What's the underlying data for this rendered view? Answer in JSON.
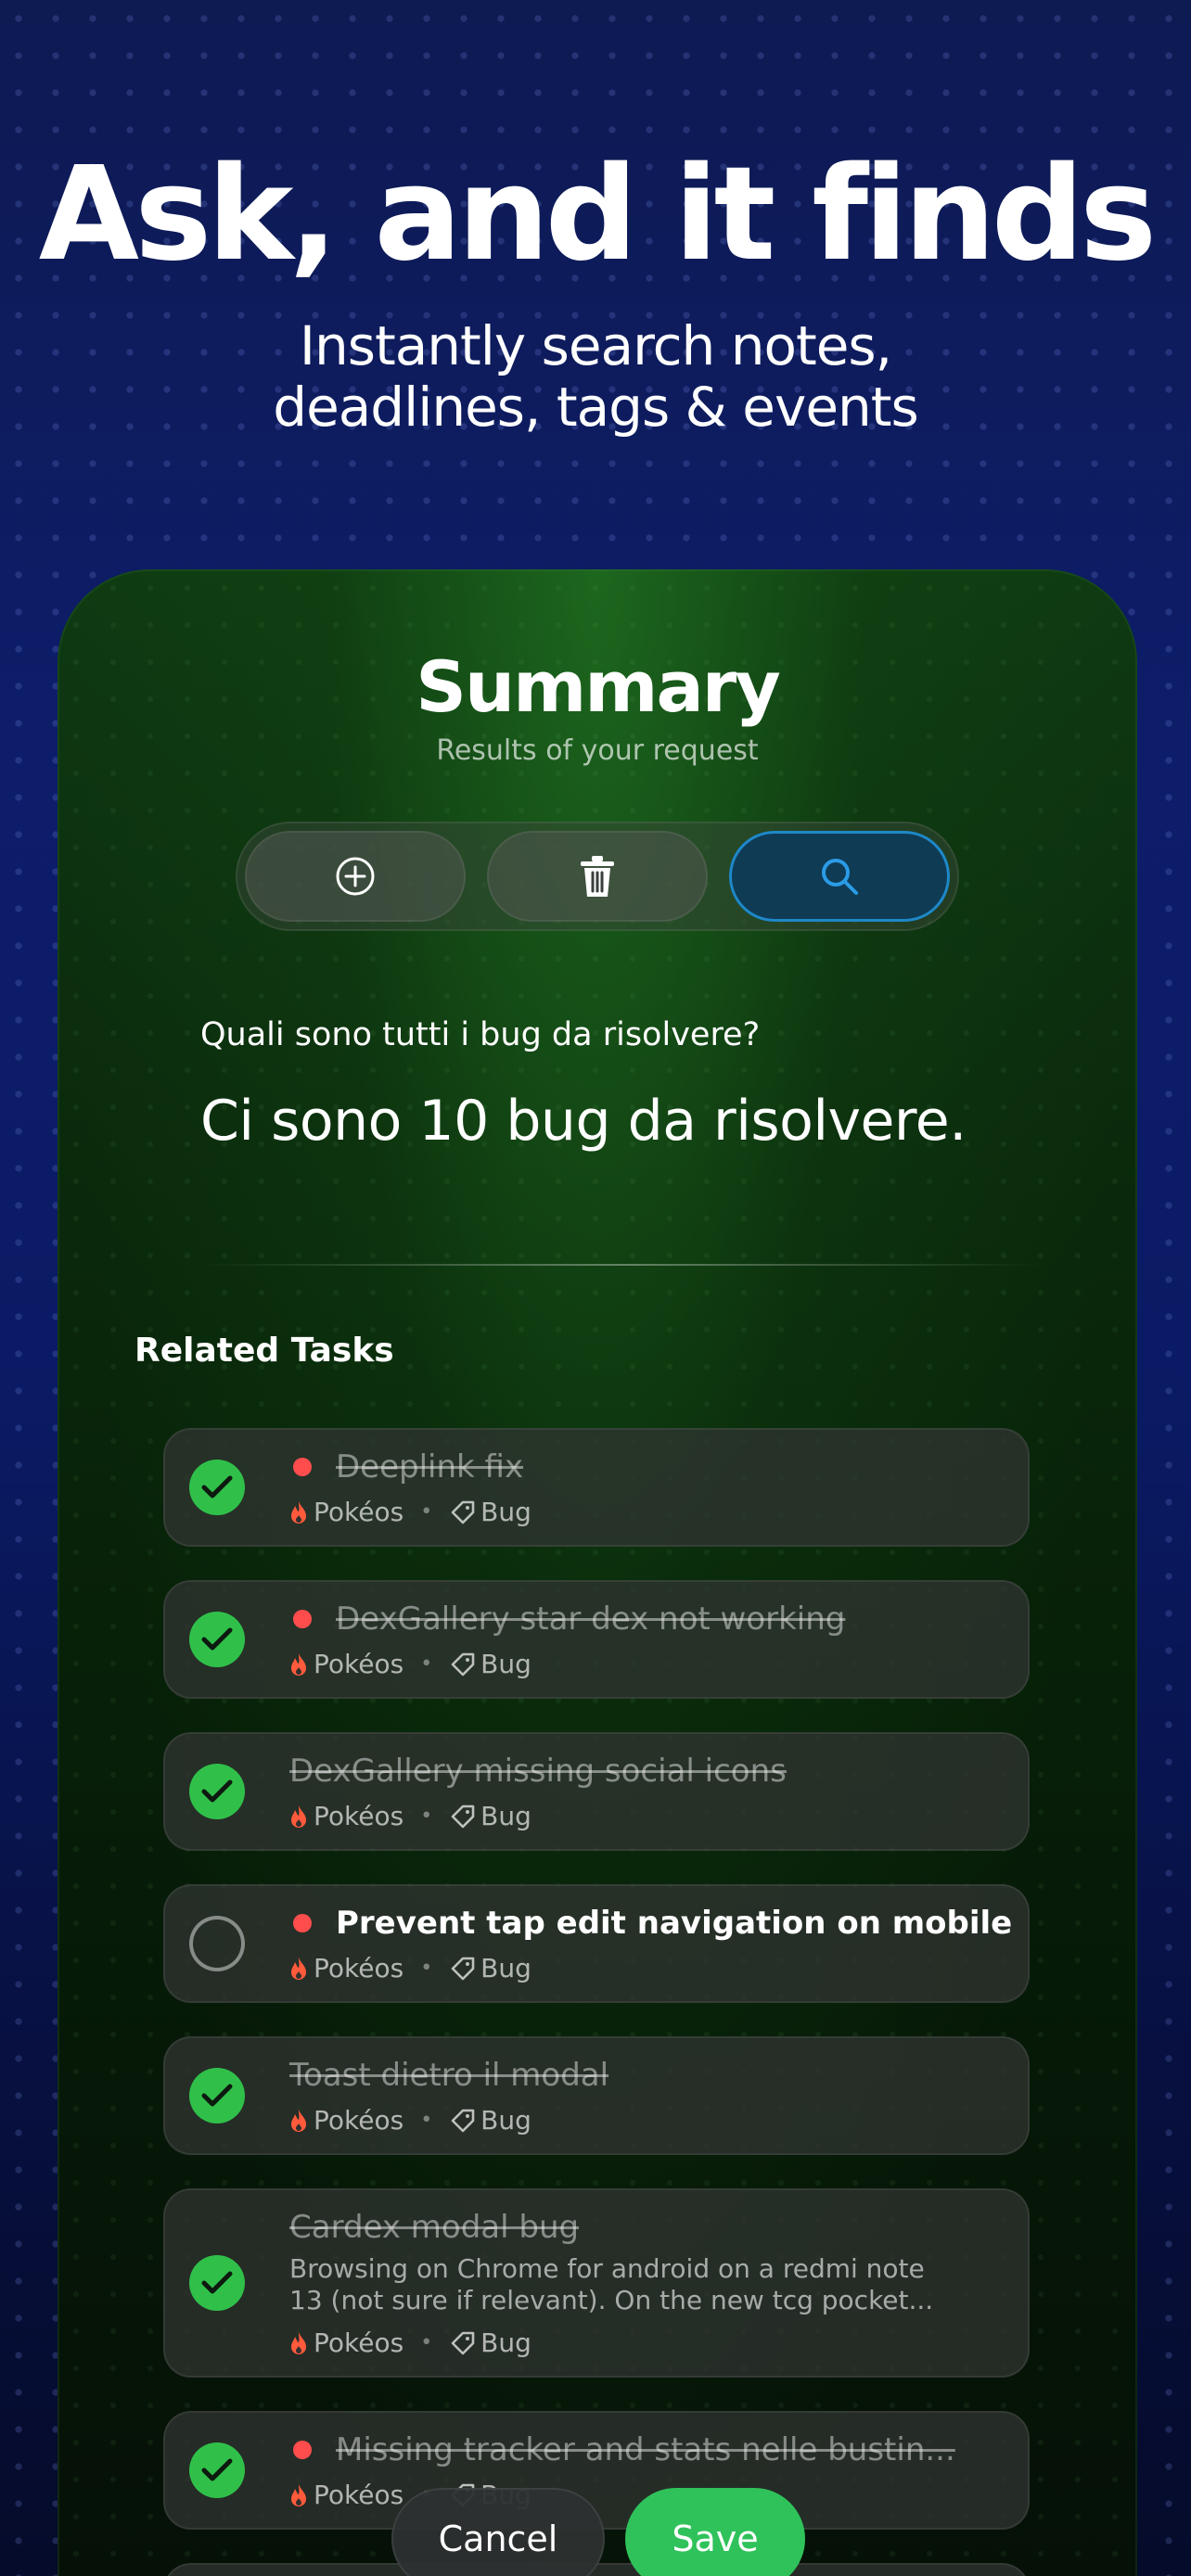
{
  "hero": {
    "title": "Ask, and it finds",
    "subtitle_line1": "Instantly search notes,",
    "subtitle_line2": "deadlines, tags & events"
  },
  "summary": {
    "title": "Summary",
    "subtitle": "Results of your request"
  },
  "segmented": {
    "buttons": [
      {
        "icon": "plus-circle-icon",
        "active": false
      },
      {
        "icon": "trash-icon",
        "active": false
      },
      {
        "icon": "search-icon",
        "active": true
      }
    ],
    "active_color": "#1e88c8"
  },
  "query": {
    "question": "Quali sono tutti i bug da risolvere?",
    "answer": "Ci sono 10 bug da risolvere."
  },
  "related": {
    "heading": "Related Tasks",
    "tasks": [
      {
        "title": "Deeplink fix",
        "done": true,
        "priority_dot": true,
        "project": "Pokéos",
        "tag": "Bug"
      },
      {
        "title": "DexGallery star dex not working",
        "done": true,
        "priority_dot": true,
        "project": "Pokéos",
        "tag": "Bug"
      },
      {
        "title": "DexGallery missing social icons",
        "done": true,
        "priority_dot": false,
        "project": "Pokéos",
        "tag": "Bug"
      },
      {
        "title": "Prevent tap edit navigation on mobile",
        "done": false,
        "priority_dot": true,
        "project": "Pokéos",
        "tag": "Bug"
      },
      {
        "title": "Toast dietro il modal",
        "done": true,
        "priority_dot": false,
        "project": "Pokéos",
        "tag": "Bug"
      },
      {
        "title": "Cardex modal bug",
        "done": true,
        "priority_dot": false,
        "description_line1": "Browsing on Chrome for android on a redmi note",
        "description_line2": "13 (not sure if relevant).  On the new tcg pocket...",
        "project": "Pokéos",
        "tag": "Bug"
      },
      {
        "title": "Missing tracker and stats nelle bustin...",
        "done": true,
        "priority_dot": true,
        "project": "Pokéos",
        "tag": "Bug"
      }
    ]
  },
  "actions": {
    "cancel_label": "Cancel",
    "save_label": "Save"
  },
  "colors": {
    "check_green": "#30c04a",
    "priority_red": "#ff4d4d",
    "save_green": "#2fc25a",
    "project_flame": "#ff5a3c"
  }
}
